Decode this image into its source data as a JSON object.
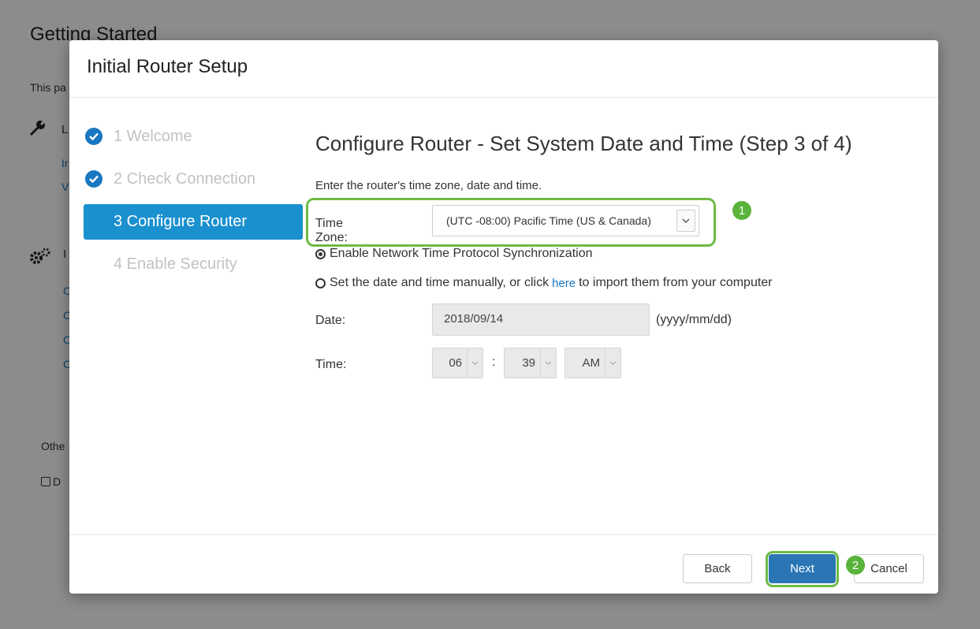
{
  "background": {
    "title": "Getting Started",
    "description_fragment": "This pa",
    "section1_fragment": "L",
    "links1": [
      "Ir",
      "V"
    ],
    "section2_fragment": "I",
    "links2": [
      "C",
      "C",
      "C",
      "C"
    ],
    "other_fragment": "Othe",
    "checkbox_fragment": "D"
  },
  "modal": {
    "title": "Initial Router Setup",
    "steps": [
      {
        "label": "1 Welcome",
        "state": "done"
      },
      {
        "label": "2 Check Connection",
        "state": "done"
      },
      {
        "label": "3 Configure Router",
        "state": "active"
      },
      {
        "label": "4 Enable Security",
        "state": "pending"
      }
    ],
    "heading": "Configure Router - Set System Date and Time (Step 3 of 4)",
    "intro": "Enter the router's time zone, date and time.",
    "time_zone": {
      "label": "Time Zone:",
      "value": "(UTC -08:00) Pacific Time (US & Canada)"
    },
    "badge1": "1",
    "badge2": "2",
    "ntp_option": {
      "label": "Enable Network Time Protocol Synchronization",
      "selected": true
    },
    "manual_option": {
      "label_before": "Set the date and time manually, or click",
      "link": "here",
      "label_after": "to import them from your computer",
      "selected": false
    },
    "date": {
      "label": "Date:",
      "value": "2018/09/14",
      "format": "(yyyy/mm/dd)"
    },
    "time": {
      "label": "Time:",
      "hour": "06",
      "separator": ":",
      "minute": "39",
      "period": "AM"
    },
    "buttons": {
      "back": "Back",
      "next": "Next",
      "cancel": "Cancel"
    }
  },
  "colors": {
    "accent": "#1a90cf",
    "primary_button": "#2a76b5",
    "highlight": "#6dbb45",
    "link": "#1a78c2"
  }
}
